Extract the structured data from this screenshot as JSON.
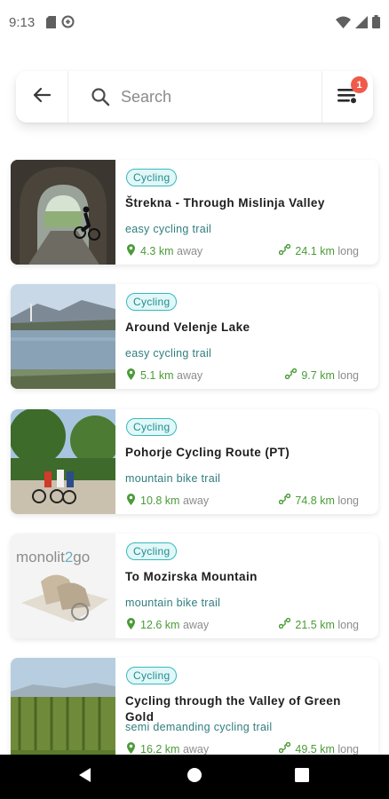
{
  "status_bar": {
    "time": "9:13",
    "left_icons": [
      "sd-card-icon",
      "data-saver-icon"
    ],
    "right_icons": [
      "wifi-icon",
      "signal-icon",
      "battery-icon"
    ]
  },
  "search": {
    "placeholder": "Search",
    "value": "",
    "filter_badge_count": "1"
  },
  "colors": {
    "accent_teal": "#36b9be",
    "chip_bg": "#e2f7f7",
    "green_value": "#4b9b38",
    "badge_red": "#ef5a4b"
  },
  "results": [
    {
      "category": "Cycling",
      "title": "Štrekna - Through Mislinja Valley",
      "type": "easy cycling trail",
      "distance": "4.3 km",
      "distance_suffix": "away",
      "length": "24.1 km",
      "length_suffix": "long",
      "image": "tunnel-cyclist-photo"
    },
    {
      "category": "Cycling",
      "title": "Around Velenje Lake",
      "type": "easy cycling trail",
      "distance": "5.1 km",
      "distance_suffix": "away",
      "length": "9.7 km",
      "length_suffix": "long",
      "image": "lake-photo"
    },
    {
      "category": "Cycling",
      "title": "Pohorje Cycling Route (PT)",
      "type": "mountain bike trail",
      "distance": "10.8 km",
      "distance_suffix": "away",
      "length": "74.8 km",
      "length_suffix": "long",
      "image": "cyclists-group-photo"
    },
    {
      "category": "Cycling",
      "title": "To Mozirska Mountain",
      "type": "mountain bike trail",
      "distance": "12.6 km",
      "distance_suffix": "away",
      "length": "21.5 km",
      "length_suffix": "long",
      "image": "monolit2go-boots-photo",
      "image_logo_text": "monolit2go"
    },
    {
      "category": "Cycling",
      "title": "Cycling through the Valley of Green Gold",
      "type": "semi demanding cycling trail",
      "distance": "16.2 km",
      "distance_suffix": "away",
      "length": "49.5 km",
      "length_suffix": "long",
      "image": "hop-field-photo"
    }
  ]
}
